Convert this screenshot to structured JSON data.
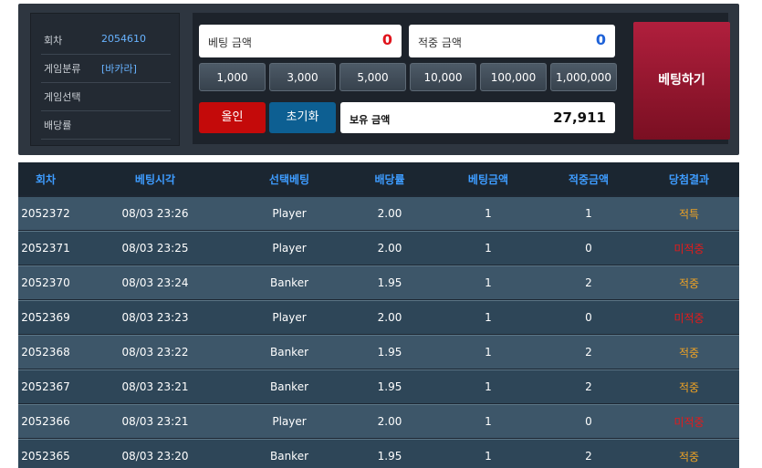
{
  "info": {
    "rows": [
      {
        "label": "회차",
        "value": "2054610"
      },
      {
        "label": "게임분류",
        "value": "[바카라]"
      },
      {
        "label": "게임선택",
        "value": ""
      },
      {
        "label": "배당률",
        "value": ""
      }
    ]
  },
  "bet_amount": {
    "label": "베팅 금액",
    "value": "0",
    "color": "#e0141c"
  },
  "win_amount": {
    "label": "적중 금액",
    "value": "0",
    "color": "#1e62d8"
  },
  "chips": [
    "1,000",
    "3,000",
    "5,000",
    "10,000",
    "100,000",
    "1,000,000"
  ],
  "all_in_label": "올인",
  "reset_label": "초기화",
  "holding": {
    "label": "보유 금액",
    "value": "27,911"
  },
  "bet_button_label": "베팅하기",
  "table": {
    "headers": [
      "회차",
      "베팅시각",
      "선택베팅",
      "배당률",
      "베팅금액",
      "적중금액",
      "당첨결과"
    ],
    "rows": [
      [
        "2052372",
        "08/03 23:26",
        "Player",
        "2.00",
        "1",
        "1",
        "적특"
      ],
      [
        "2052371",
        "08/03 23:25",
        "Player",
        "2.00",
        "1",
        "0",
        "미적중"
      ],
      [
        "2052370",
        "08/03 23:24",
        "Banker",
        "1.95",
        "1",
        "2",
        "적중"
      ],
      [
        "2052369",
        "08/03 23:23",
        "Player",
        "2.00",
        "1",
        "0",
        "미적중"
      ],
      [
        "2052368",
        "08/03 23:22",
        "Banker",
        "1.95",
        "1",
        "2",
        "적중"
      ],
      [
        "2052367",
        "08/03 23:21",
        "Banker",
        "1.95",
        "1",
        "2",
        "적중"
      ],
      [
        "2052366",
        "08/03 23:21",
        "Player",
        "2.00",
        "1",
        "0",
        "미적중"
      ],
      [
        "2052365",
        "08/03 23:20",
        "Banker",
        "1.95",
        "1",
        "2",
        "적중"
      ]
    ]
  },
  "colors": {
    "result_win": "#f0a323",
    "result_lose": "#e41b1b",
    "result_tie": "#f0a323",
    "header_text": "#3e9cff"
  }
}
